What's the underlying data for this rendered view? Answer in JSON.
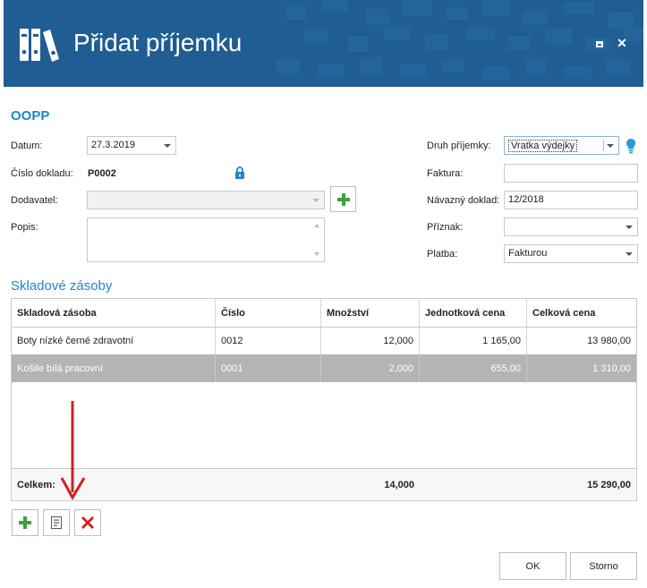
{
  "window": {
    "title": "Přidat příjemku",
    "title_color": "#1f5d93",
    "accent_color": "#1e86c9",
    "close_glyph": "✕"
  },
  "form": {
    "section_title": "OOPP",
    "datum_label": "Datum:",
    "datum_value": "27.3.2019",
    "cislo_label": "Číslo dokladu:",
    "cislo_value": "P0002",
    "dodavatel_label": "Dodavatel:",
    "dodavatel_value": "",
    "popis_label": "Popis:",
    "popis_value": "",
    "druh_label": "Druh příjemky:",
    "druh_value": "Vratka výdejky",
    "faktura_label": "Faktura:",
    "faktura_value": "",
    "navazny_label": "Návazný doklad:",
    "navazny_value": "12/2018",
    "priznak_label": "Příznak:",
    "priznak_value": "",
    "platba_label": "Platba:",
    "platba_value": "Fakturou"
  },
  "grid": {
    "title": "Skladové zásoby",
    "columns": [
      "Skladová zásoba",
      "Číslo",
      "Množství",
      "Jednotková cena",
      "Celková cena"
    ],
    "rows": [
      [
        "Boty nízké černé zdravotní",
        "0012",
        "12,000",
        "1 165,00",
        "13 980,00"
      ],
      [
        "Košile bílá pracovní",
        "0001",
        "2,000",
        "655,00",
        "1 310,00"
      ]
    ],
    "footer": {
      "label": "Celkem:",
      "quantity": "14,000",
      "total": "15 290,00"
    },
    "selected_row_color": "#b4b4b4"
  },
  "toolbar": {
    "icons": [
      "plus-icon",
      "edit-icon",
      "delete-icon"
    ]
  },
  "buttons": {
    "ok": "OK",
    "cancel": "Storno"
  },
  "annotation": {
    "arrow_color": "#d21f1f"
  }
}
